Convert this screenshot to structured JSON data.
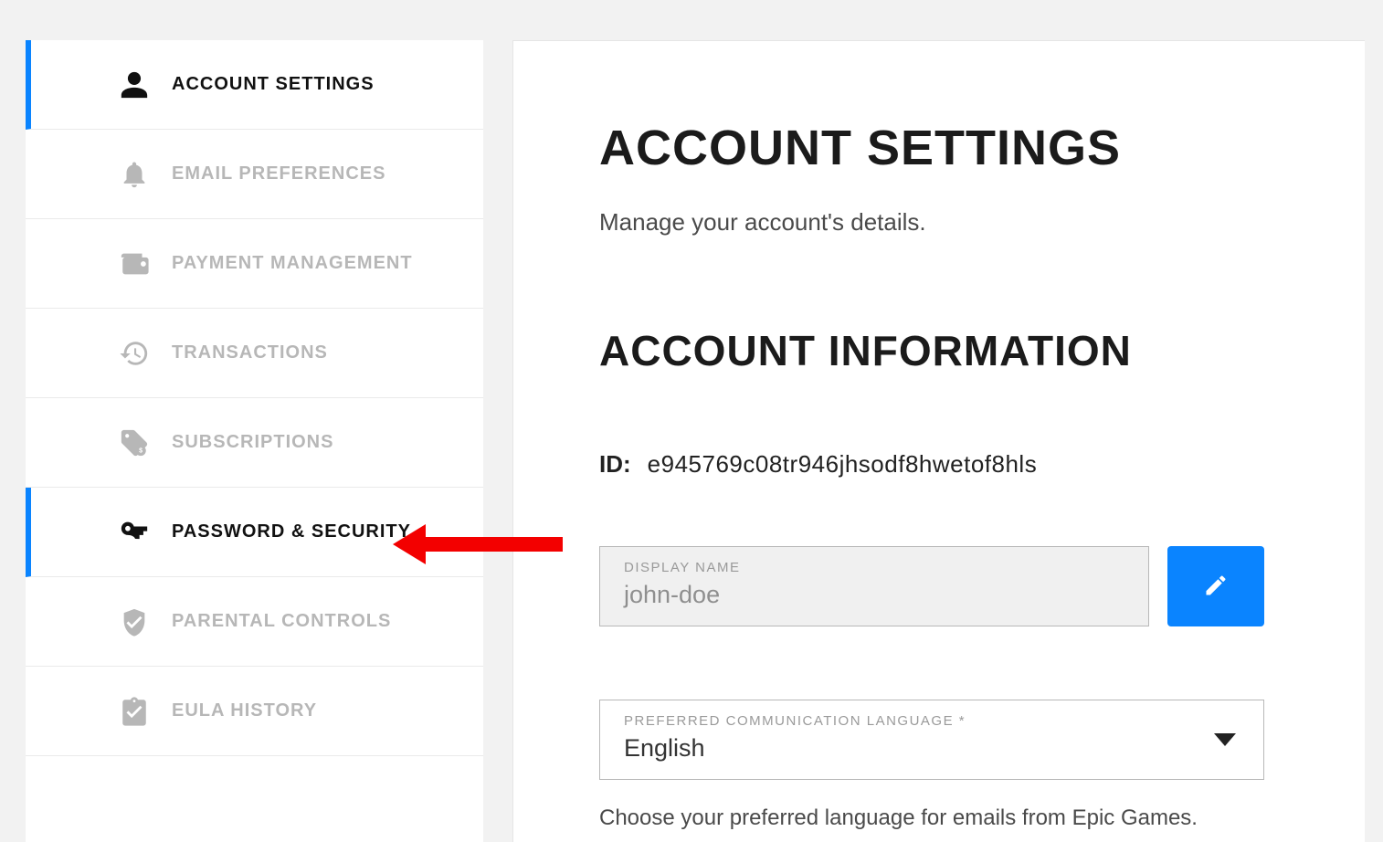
{
  "sidebar": {
    "items": [
      {
        "label": "ACCOUNT SETTINGS"
      },
      {
        "label": "EMAIL PREFERENCES"
      },
      {
        "label": "PAYMENT MANAGEMENT"
      },
      {
        "label": "TRANSACTIONS"
      },
      {
        "label": "SUBSCRIPTIONS"
      },
      {
        "label": "PASSWORD & SECURITY"
      },
      {
        "label": "PARENTAL CONTROLS"
      },
      {
        "label": "EULA HISTORY"
      }
    ]
  },
  "main": {
    "title": "ACCOUNT SETTINGS",
    "subtitle": "Manage your account's details.",
    "section_title": "ACCOUNT INFORMATION",
    "id_label": "ID:",
    "id_value": "e945769c08tr946jhsodf8hwetof8hls",
    "display_name": {
      "label": "DISPLAY NAME",
      "value": "john-doe"
    },
    "language": {
      "label": "PREFERRED COMMUNICATION LANGUAGE *",
      "value": "English",
      "helper": "Choose your preferred language for emails from Epic Games."
    }
  },
  "colors": {
    "accent": "#0a84ff",
    "annotation": "#f30000"
  }
}
